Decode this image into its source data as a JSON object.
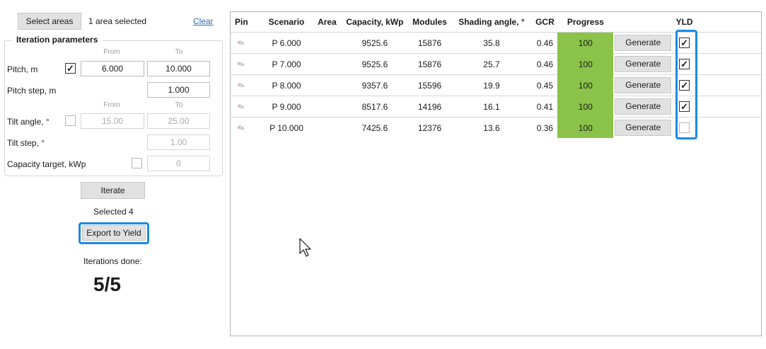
{
  "left_panel": {
    "select_areas_label": "Select areas",
    "area_status": "1 area selected",
    "clear_label": "Clear",
    "group_title": "Iteration parameters",
    "from_label": "From",
    "to_label": "To",
    "pitch": {
      "label": "Pitch, m",
      "checked": true,
      "from": "6.000",
      "to": "10.000"
    },
    "pitch_step": {
      "label": "Pitch step, m",
      "value": "1.000"
    },
    "tilt": {
      "label": "Tilt angle, °",
      "checked": false,
      "from": "15.00",
      "to": "25.00"
    },
    "tilt_step": {
      "label": "Tilt step, °",
      "value": "1.00"
    },
    "capacity_target": {
      "label": "Capacity target, kWp",
      "checked": false,
      "value": "0"
    },
    "iterate_label": "Iterate",
    "selected_text": "Selected 4",
    "export_label": "Export to Yield",
    "iterations_label": "Iterations done:",
    "iterations_value": "5/5"
  },
  "table": {
    "columns": [
      "Pin",
      "Scenario",
      "Area",
      "Capacity, kWp",
      "Modules",
      "Shading angle, °",
      "GCR",
      "Progress",
      "",
      "YLD"
    ],
    "generate_label": "Generate",
    "rows": [
      {
        "scenario": "P 6.000",
        "area": "",
        "capacity": "9525.6",
        "modules": "15876",
        "shading": "35.8",
        "gcr": "0.46",
        "progress": "100",
        "yld": true
      },
      {
        "scenario": "P 7.000",
        "area": "",
        "capacity": "9525.6",
        "modules": "15876",
        "shading": "25.7",
        "gcr": "0.46",
        "progress": "100",
        "yld": true
      },
      {
        "scenario": "P 8.000",
        "area": "",
        "capacity": "9357.6",
        "modules": "15596",
        "shading": "19.9",
        "gcr": "0.45",
        "progress": "100",
        "yld": true
      },
      {
        "scenario": "P 9.000",
        "area": "",
        "capacity": "8517.6",
        "modules": "14196",
        "shading": "16.1",
        "gcr": "0.41",
        "progress": "100",
        "yld": true
      },
      {
        "scenario": "P 10.000",
        "area": "",
        "capacity": "7425.6",
        "modules": "12376",
        "shading": "13.6",
        "gcr": "0.36",
        "progress": "100",
        "yld": false
      }
    ]
  },
  "colors": {
    "progress_fill": "#8bc34a",
    "highlight": "#1b8ae6"
  },
  "icons": {
    "pin": "pin-icon",
    "cursor": "mouse-pointer-icon",
    "check": "checkmark-icon"
  }
}
